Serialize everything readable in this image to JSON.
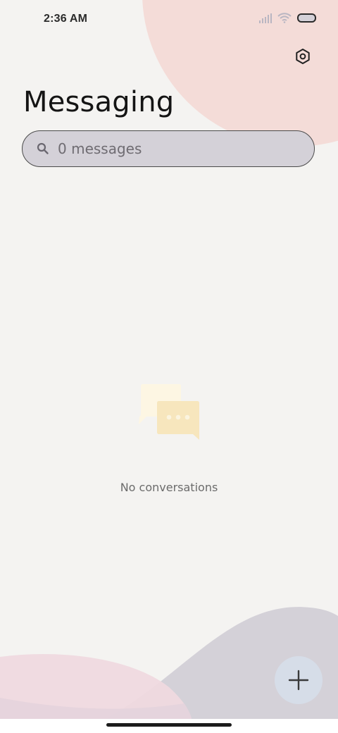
{
  "status_bar": {
    "time": "2:36 AM"
  },
  "header": {
    "title": "Messaging",
    "settings_icon": "settings-hexagon-icon"
  },
  "search": {
    "placeholder": "0 messages",
    "value": ""
  },
  "empty_state": {
    "icon": "chat-bubbles-icon",
    "text": "No conversations"
  },
  "fab": {
    "icon": "plus-icon"
  },
  "colors": {
    "background": "#f4f3f1",
    "top_blob": "#f4dcd8",
    "bottom_pink_wave": "#efd9df",
    "bottom_gray_wave": "#d4d1d8",
    "search_fill": "#d4d1d8",
    "fab_fill": "#d6dde8",
    "chat_back": "#fdf6e3",
    "chat_front": "#f7e6bd"
  }
}
